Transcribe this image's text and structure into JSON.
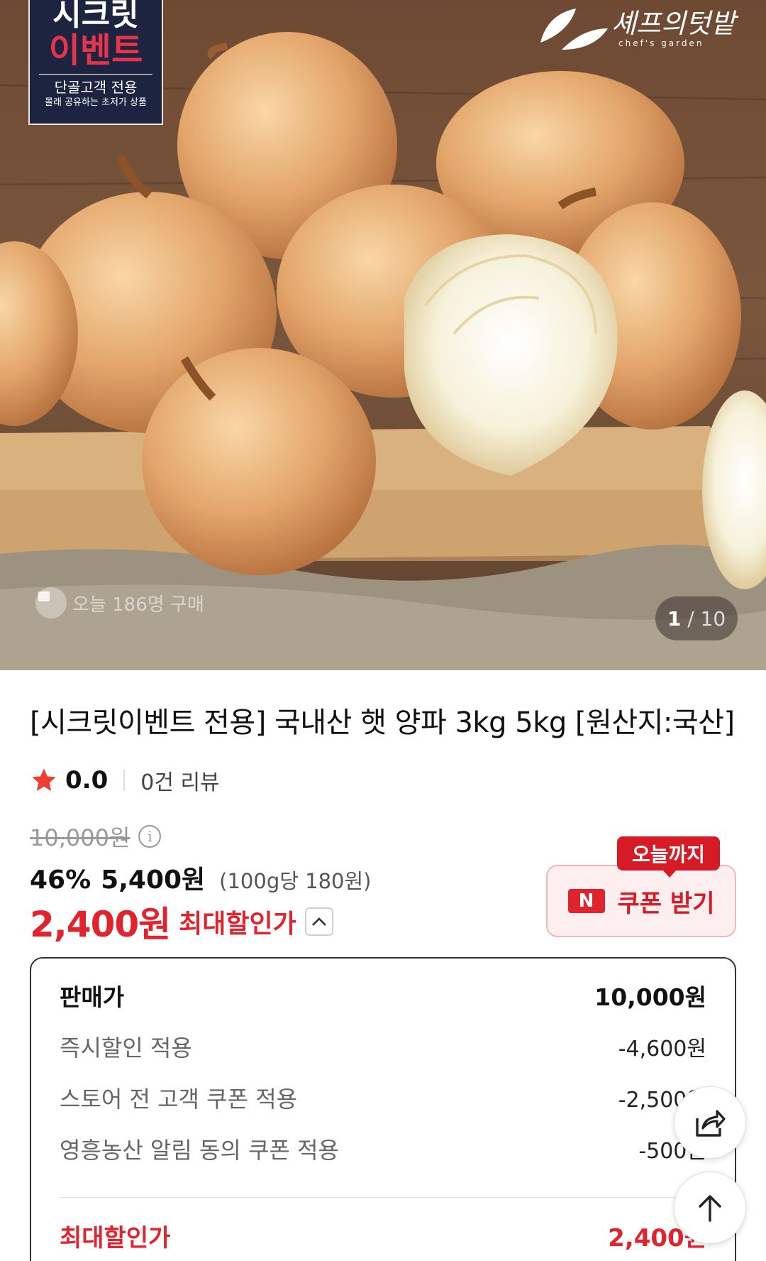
{
  "hero": {
    "event_line1": "시크릿",
    "event_line2": "이벤트",
    "event_line3": "단골고객 전용",
    "event_line4": "몰래 공유하는 초저가 상품",
    "brand_name": "셰프의텃밭",
    "brand_sub": "chef's garden",
    "today_buy": "오늘 186명 구매",
    "counter_current": "1",
    "counter_total": "/ 10"
  },
  "product": {
    "title": "[시크릿이벤트 전용] 국내산 햇 양파 3kg 5kg [원산지:국산]",
    "rating": "0.0",
    "reviews": "0건 리뷰",
    "original_price": "10,000원",
    "discount_rate": "46%",
    "sale_price": "5,400원",
    "unit_price": "(100g당 180원)",
    "max_discount_price": "2,400원",
    "max_discount_label": "최대할인가"
  },
  "coupon": {
    "tag": "오늘까지",
    "badge": "N",
    "label": "쿠폰 받기"
  },
  "breakdown": {
    "rows": [
      {
        "label": "판매가",
        "value": "10,000원"
      },
      {
        "label": "즉시할인 적용",
        "value": "-4,600원"
      },
      {
        "label": "스토어 전 고객 쿠폰 적용",
        "value": "-2,500원"
      },
      {
        "label": "영흥농산 알림 동의 쿠폰 적용",
        "value": "-500원"
      }
    ],
    "total_label": "최대할인가",
    "total_value": "2,400원"
  },
  "colors": {
    "accent_red": "#e1232d",
    "coupon_bg": "#fdeeef",
    "event_navy": "#1c2440"
  },
  "icons": [
    "star-icon",
    "info-icon",
    "chevron-up-icon",
    "share-icon",
    "arrow-up-icon"
  ]
}
